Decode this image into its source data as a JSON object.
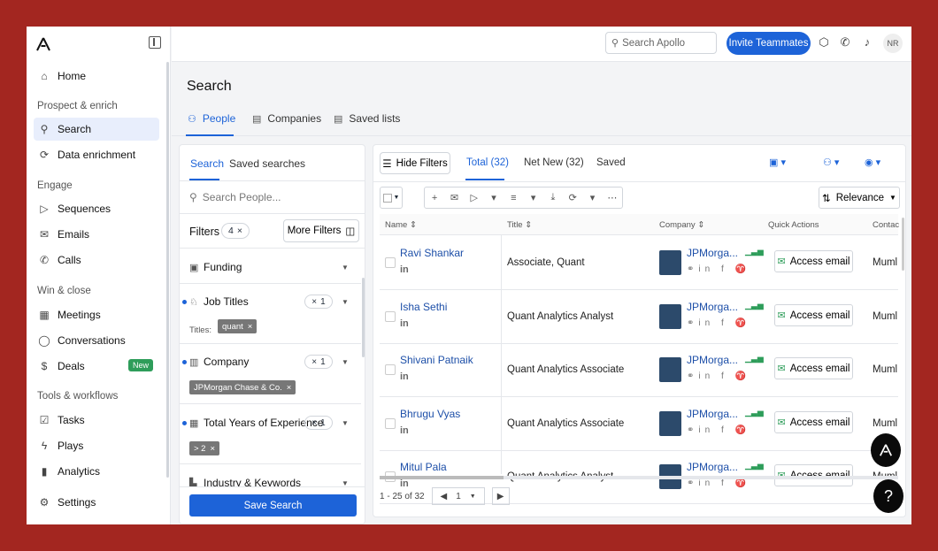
{
  "sidebar": {
    "items": [
      {
        "label": "Home",
        "icon": "home-icon"
      },
      {
        "label": "Search",
        "icon": "search-icon"
      },
      {
        "label": "Data enrichment",
        "icon": "enrich-icon"
      },
      {
        "label": "Sequences",
        "icon": "send-icon"
      },
      {
        "label": "Emails",
        "icon": "mail-icon"
      },
      {
        "label": "Calls",
        "icon": "phone-icon"
      },
      {
        "label": "Meetings",
        "icon": "calendar-icon"
      },
      {
        "label": "Conversations",
        "icon": "chat-icon"
      },
      {
        "label": "Deals",
        "icon": "dollar-icon",
        "badge": "New"
      },
      {
        "label": "Tasks",
        "icon": "task-icon"
      },
      {
        "label": "Plays",
        "icon": "bolt-icon"
      },
      {
        "label": "Analytics",
        "icon": "chart-icon"
      },
      {
        "label": "Settings",
        "icon": "gear-icon"
      }
    ],
    "sections": [
      "Prospect & enrich",
      "Engage",
      "Win & close",
      "Tools & workflows"
    ]
  },
  "topbar": {
    "search_placeholder": "Search Apollo",
    "invite_label": "Invite Teammates",
    "avatar_initials": "NR"
  },
  "page": {
    "title": "Search",
    "tabs": [
      "People",
      "Companies",
      "Saved lists"
    ]
  },
  "filters": {
    "tabs": [
      "Search",
      "Saved searches"
    ],
    "search_placeholder": "Search People...",
    "label": "Filters",
    "count": "4",
    "more_label": "More Filters",
    "rows": [
      {
        "label": "Funding"
      },
      {
        "label": "Job Titles",
        "count": "1"
      },
      {
        "label": "Company",
        "count": "1"
      },
      {
        "label": "Total Years of Experience",
        "count": "1"
      },
      {
        "label": "Industry & Keywords"
      }
    ],
    "titles_label": "Titles:",
    "chips": [
      "quant",
      "JPMorgan Chase & Co.",
      "> 2"
    ],
    "save_label": "Save Search"
  },
  "results": {
    "hide_filters_label": "Hide Filters",
    "tabs": [
      "Total (32)",
      "Net New (32)",
      "Saved"
    ],
    "sort_label": "Relevance",
    "columns": [
      "Name",
      "Title",
      "Company",
      "Quick Actions",
      "Contac"
    ],
    "rows": [
      {
        "name": "Ravi Shankar",
        "title": "Associate, Quant",
        "company": "JPMorga...",
        "action": "Access email",
        "contact": "Muml"
      },
      {
        "name": "Isha Sethi",
        "title": "Quant Analytics Analyst",
        "company": "JPMorga...",
        "action": "Access email",
        "contact": "Muml"
      },
      {
        "name": "Shivani Patnaik",
        "title": "Quant Analytics Associate",
        "company": "JPMorga...",
        "action": "Access email",
        "contact": "Muml"
      },
      {
        "name": "Bhrugu Vyas",
        "title": "Quant Analytics Associate",
        "company": "JPMorga...",
        "action": "Access email",
        "contact": "Muml"
      },
      {
        "name": "Mitul Pala",
        "title": "Quant Analytics Analyst",
        "company": "JPMorga...",
        "action": "Access email",
        "contact": "Muml"
      }
    ],
    "pager": {
      "range": "1 - 25 of 32",
      "page": "1"
    }
  },
  "colors": {
    "accent": "#1d63d8",
    "frame": "#a32620",
    "new_badge": "#2e9d5a"
  }
}
